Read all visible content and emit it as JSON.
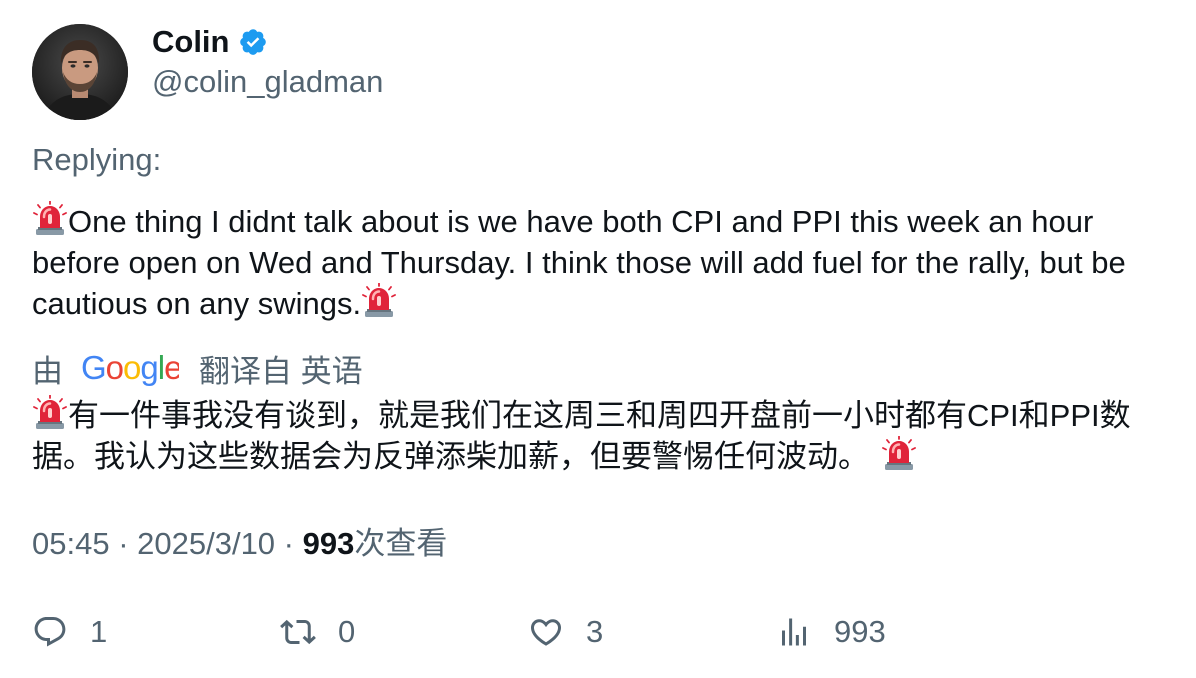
{
  "author": {
    "display_name": "Colin",
    "handle": "@colin_gladman",
    "verified": true,
    "avatar_icon": "user-avatar-photo"
  },
  "replying_label": "Replying:",
  "tweet": {
    "text": "One thing I didnt talk about is we have both CPI and PPI this week an hour before open on Wed and Thursday. I think those will add fuel for the rally, but be cautious on any swings.",
    "leading_emoji": "siren-icon",
    "trailing_emoji": "siren-icon"
  },
  "translation": {
    "prefix": "由",
    "provider": "Google",
    "suffix": "翻译自 英语",
    "text": "有一件事我没有谈到，就是我们在这周三和周四开盘前一小时都有CPI和PPI数据。我认为这些数据会为反弹添柴加薪，但要警惕任何波动。"
  },
  "meta": {
    "time": "05:45",
    "separator": " · ",
    "date": "2025/3/10",
    "views": "993",
    "views_label": "次查看"
  },
  "actions": {
    "reply": {
      "icon": "reply-icon",
      "count": "1"
    },
    "retweet": {
      "icon": "retweet-icon",
      "count": "0"
    },
    "like": {
      "icon": "heart-icon",
      "count": "3"
    },
    "views": {
      "icon": "analytics-icon",
      "count": "993"
    }
  },
  "colors": {
    "text_primary": "#0f1419",
    "text_secondary": "#536471",
    "verified_blue": "#1d9bf0",
    "siren_red": "#e0243a"
  }
}
